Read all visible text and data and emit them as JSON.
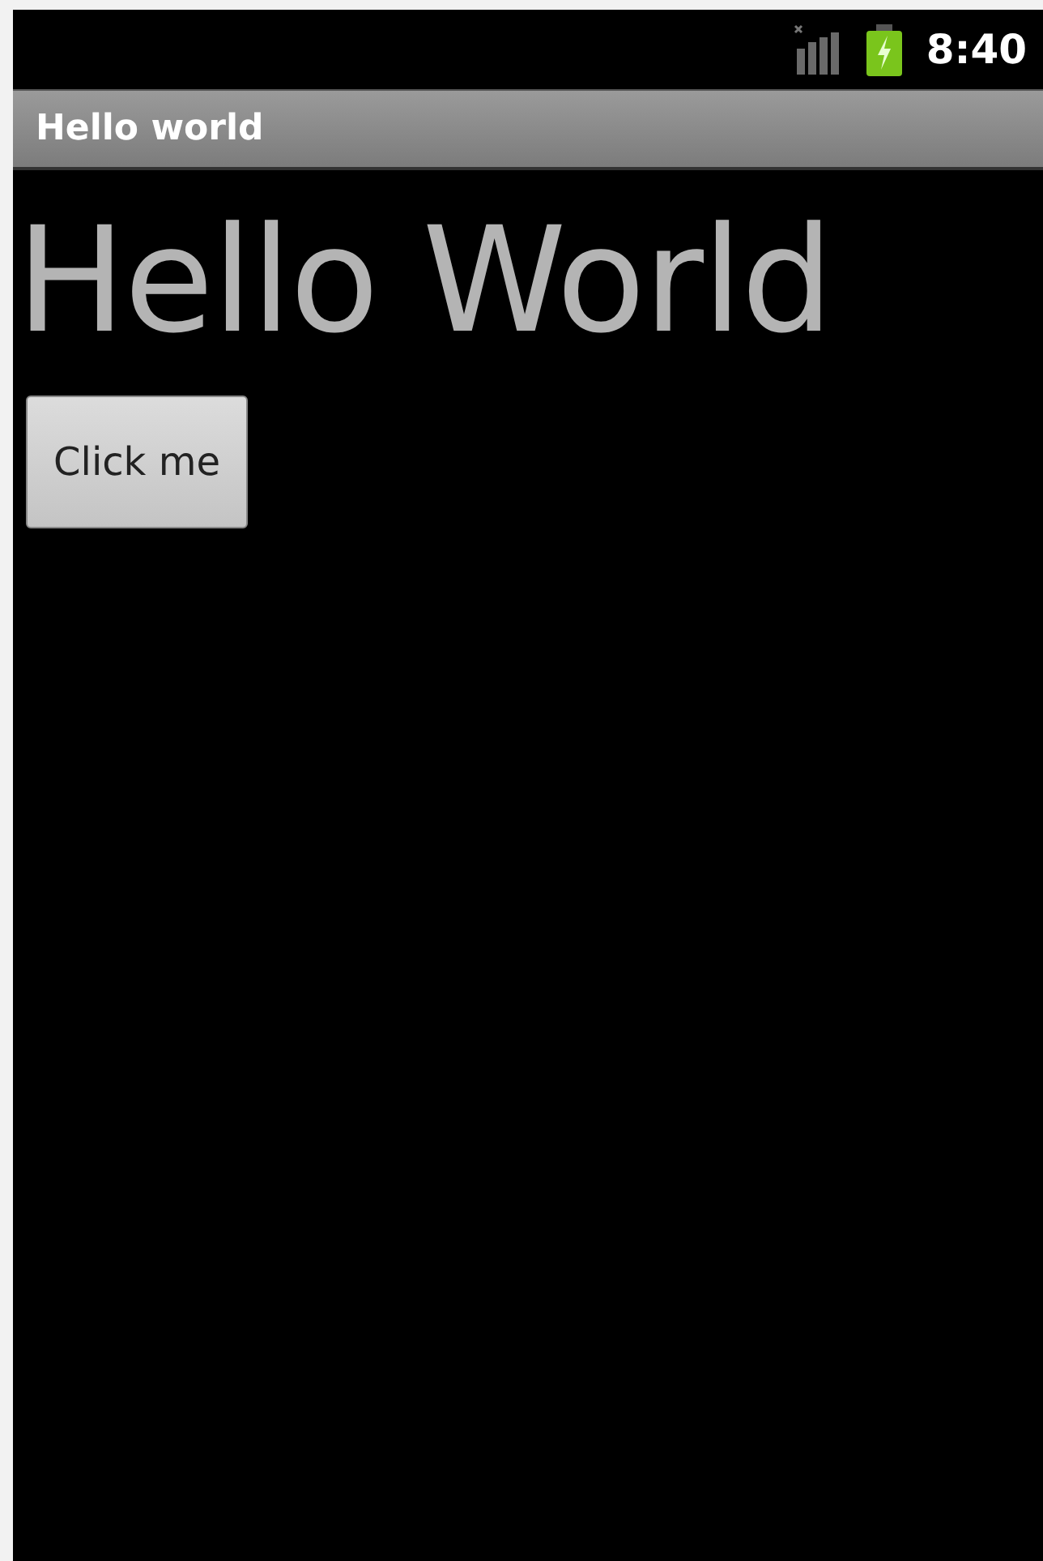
{
  "status_bar": {
    "time": "8:40"
  },
  "title_bar": {
    "title": "Hello world"
  },
  "content": {
    "heading": "Hello World",
    "button": "Click me"
  }
}
